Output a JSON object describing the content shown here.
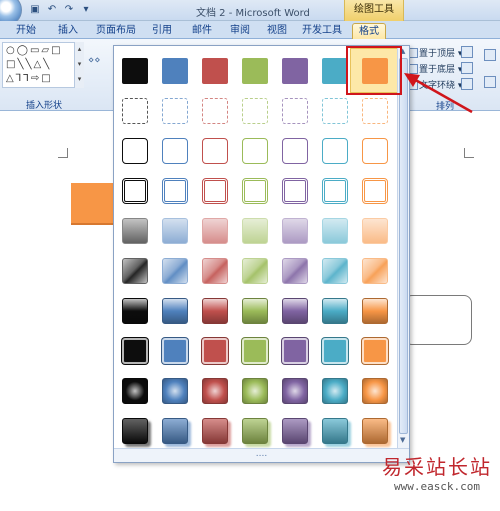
{
  "window": {
    "title": "文档 2 - Microsoft Word",
    "context_title": "绘图工具"
  },
  "tabs": [
    "开始",
    "插入",
    "页面布局",
    "引用",
    "邮件",
    "审阅",
    "视图",
    "开发工具",
    "格式"
  ],
  "ribbon": {
    "insert_shapes_group": "插入形状",
    "arrange_group": "排列",
    "bring_to_front": "置于顶层",
    "send_to_back": "置于底层",
    "text_wrapping": "文字环绕"
  },
  "gallery": {
    "bottom_grip": "....",
    "selected_color": "orange",
    "colors": [
      "#0d0d0d",
      "#4f81bd",
      "#c0504d",
      "#9bbb59",
      "#8064a2",
      "#4bacc6",
      "#f79646"
    ],
    "row_styles": [
      "solid",
      "dashed",
      "thin-outline",
      "double-outline",
      "gradient-light",
      "gloss",
      "bevel",
      "bordered",
      "radial",
      "shadow"
    ]
  },
  "watermark": {
    "title": "易采站长站",
    "url": "www.easck.com"
  }
}
